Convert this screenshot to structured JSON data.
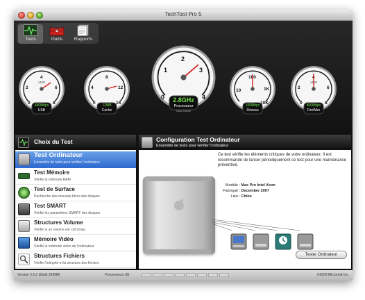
{
  "window": {
    "title": "TechTool Pro 5"
  },
  "toolbar": {
    "items": [
      {
        "label": "Tests",
        "icon": "heartbeat-icon",
        "active": true
      },
      {
        "label": "Outils",
        "icon": "toolbox-icon"
      },
      {
        "label": "Rapports",
        "icon": "report-icon"
      }
    ]
  },
  "gauges": [
    {
      "name": "usb",
      "ticks": [
        "0",
        "2",
        "4",
        "6",
        "8"
      ],
      "multiplier": "x100",
      "value": "480Mbps",
      "label": "USB",
      "value_color": "#74e24a"
    },
    {
      "name": "cache",
      "ticks": [
        "0",
        "4",
        "8",
        "12",
        "16"
      ],
      "multiplier": "",
      "value": "12MB",
      "label": "Cache",
      "value_color": "#74e24a"
    },
    {
      "name": "processeur",
      "ticks": [
        "0",
        "1",
        "2",
        "3",
        "4"
      ],
      "multiplier": "",
      "value": "2.8GHz",
      "label": "Processeur",
      "sublabel": "Xeon 2.8GHz",
      "value_color": "#74e24a"
    },
    {
      "name": "reseau",
      "ticks": [
        "10",
        "100",
        "1K",
        "10K"
      ],
      "multiplier": "",
      "value": "100Mbps",
      "label": "Réseau",
      "value_color": "#74e24a"
    },
    {
      "name": "firewire",
      "ticks": [
        "0",
        "2",
        "4",
        "6",
        "8"
      ],
      "multiplier": "x100",
      "value": "800Mbps",
      "label": "FireWire",
      "value_color": "#74e24a"
    }
  ],
  "left_panel": {
    "title": "Choix du Test",
    "items": [
      {
        "name": "Test Ordinateur",
        "desc": "Ensemble de tests pour vérifier l'ordinateur",
        "icon": "computer-test-icon",
        "selected": true
      },
      {
        "name": "Test Mémoire",
        "desc": "Vérifie la mémoire RAM",
        "icon": "memory-chip-icon"
      },
      {
        "name": "Test de Surface",
        "desc": "Recherche des mauvais blocs des disques",
        "icon": "disk-surface-icon"
      },
      {
        "name": "Test SMART",
        "desc": "Vérifie les paramètres SMART des disques",
        "icon": "smart-drive-icon"
      },
      {
        "name": "Structures Volume",
        "desc": "Vérifie si un volume est corrompu",
        "icon": "volume-structure-icon"
      },
      {
        "name": "Mémoire Vidéo",
        "desc": "Vérifie la mémoire vidéo de l'ordinateur",
        "icon": "video-memory-icon"
      },
      {
        "name": "Structures Fichiers",
        "desc": "Vérifie l'intégrité et la structure des fichiers",
        "icon": "file-structure-icon"
      }
    ]
  },
  "right_panel": {
    "title": "Configuration Test Ordinateur",
    "subtitle": "Ensemble de tests pour vérifier l'ordinateur",
    "description": "Ce test vérifie les éléments critiques de votre ordinateur. Il est recommandé de lancer périodiquement ce test pour une maintenance préventive.",
    "info": [
      {
        "label": "Modèle :",
        "value": "Mac Pro Intel Xeon"
      },
      {
        "label": "Fabriqué :",
        "value": "December 2007"
      },
      {
        "label": "Lieu :",
        "value": "Chine"
      }
    ],
    "button": "Tester Ordinateur"
  },
  "status_bar": {
    "version": "Version 5.0.2 (Build 3938M)",
    "processors_label": "Processeurs (8) :",
    "processors_count": 8,
    "copyright": "©2009 Micromat Inc."
  },
  "colors": {
    "accent": "#2e6bd0",
    "gauge_value": "#74e24a",
    "needle": "#d21e1e"
  }
}
